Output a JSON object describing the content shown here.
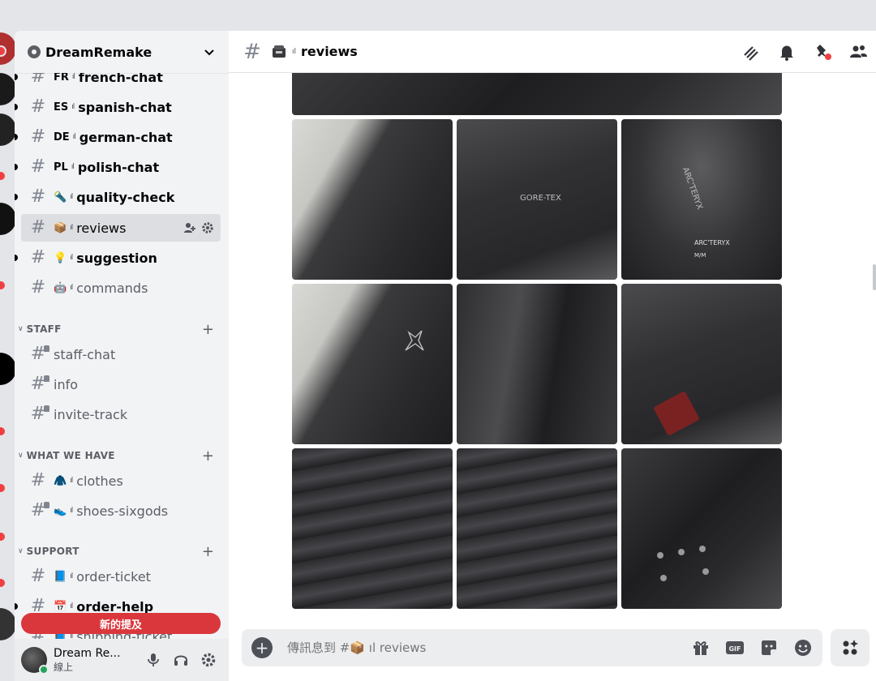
{
  "server": {
    "name": "DreamRemake"
  },
  "channels": [
    {
      "emoji": "FR",
      "name": "french-chat",
      "unread": true
    },
    {
      "emoji": "ES",
      "name": "spanish-chat",
      "unread": true
    },
    {
      "emoji": "DE",
      "name": "german-chat",
      "unread": true
    },
    {
      "emoji": "PL",
      "name": "polish-chat",
      "unread": true
    },
    {
      "emoji": "🔦",
      "name": "quality-check",
      "unread": true
    },
    {
      "emoji": "📦",
      "name": "reviews",
      "active": true
    },
    {
      "emoji": "💡",
      "name": "suggestion",
      "unread": true
    },
    {
      "emoji": "🤖",
      "name": "commands"
    }
  ],
  "categories": {
    "staff": {
      "name": "STAFF",
      "channels": [
        {
          "name": "staff-chat"
        },
        {
          "name": "info"
        },
        {
          "name": "invite-track"
        }
      ]
    },
    "what_we_have": {
      "name": "WHAT WE HAVE",
      "channels": [
        {
          "emoji": "🧥",
          "name": "clothes"
        },
        {
          "emoji": "👟",
          "name": "shoes-sixgods"
        }
      ]
    },
    "support": {
      "name": "SUPPORT",
      "channels": [
        {
          "emoji": "📘",
          "name": "order-ticket"
        },
        {
          "emoji": "📅",
          "name": "order-help",
          "unread": true
        },
        {
          "emoji": "📘",
          "name": "shipping-ticket"
        }
      ]
    }
  },
  "separator": "ıl",
  "new_mentions": "新的提及",
  "user": {
    "name": "Dream Re...",
    "status": "線上"
  },
  "header": {
    "channel_name": "reviews"
  },
  "composer": {
    "placeholder": "傳訊息到 #📦 ıl reviews",
    "gif_label": "GIF"
  },
  "gallery_marks": {
    "gore_tex": "GORE-TEX",
    "arcteryx": "ARC'TERYX",
    "label": "ARC'TERYX",
    "label_sub": "M/M"
  },
  "colors": {
    "accent": "#da373c",
    "online": "#23a55a",
    "active_bg": "#dcdee1"
  }
}
